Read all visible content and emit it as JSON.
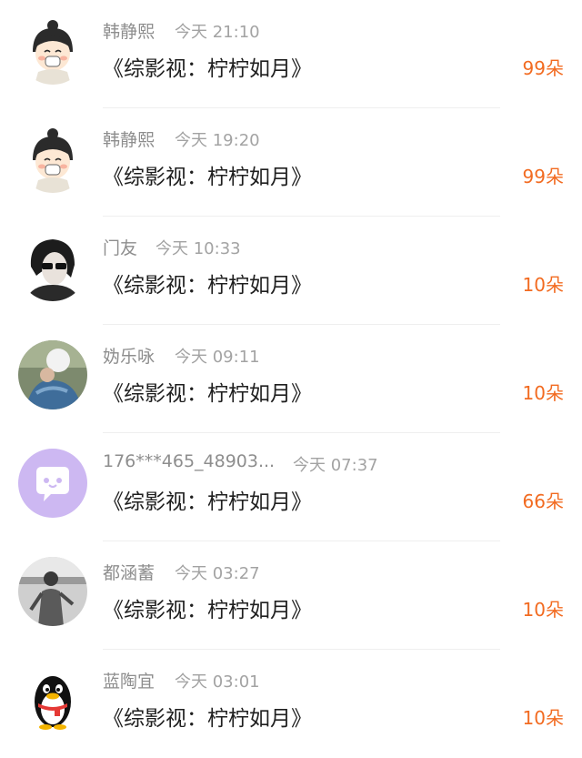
{
  "comments": [
    {
      "name": "韩静熙",
      "time": "今天 21:10",
      "text": "《综影视：柠柠如月》",
      "gifts": "99朵",
      "avatar": "cartoon-girl-avatar"
    },
    {
      "name": "韩静熙",
      "time": "今天 19:20",
      "text": "《综影视：柠柠如月》",
      "gifts": "99朵",
      "avatar": "cartoon-girl-avatar"
    },
    {
      "name": "门友",
      "time": "今天 10:33",
      "text": "《综影视：柠柠如月》",
      "gifts": "10朵",
      "avatar": "sunglasses-man-avatar"
    },
    {
      "name": "妫乐咏",
      "time": "今天 09:11",
      "text": "《综影视：柠柠如月》",
      "gifts": "10朵",
      "avatar": "photo-avatar"
    },
    {
      "name": "176***465_48903...",
      "time": "今天 07:37",
      "text": "《综影视：柠柠如月》",
      "gifts": "66朵",
      "avatar": "chat-bubble-avatar"
    },
    {
      "name": "都涵蓄",
      "time": "今天 03:27",
      "text": "《综影视：柠柠如月》",
      "gifts": "10朵",
      "avatar": "grayscale-person-avatar"
    },
    {
      "name": "蓝陶宜",
      "time": "今天 03:01",
      "text": "《综影视：柠柠如月》",
      "gifts": "10朵",
      "avatar": "penguin-avatar"
    }
  ],
  "colors": {
    "gift": "#f26b21",
    "name": "#8e8e8e",
    "text": "#1f1f1f",
    "divider": "#efefef",
    "purple_avatar": "#cdb8f2"
  }
}
